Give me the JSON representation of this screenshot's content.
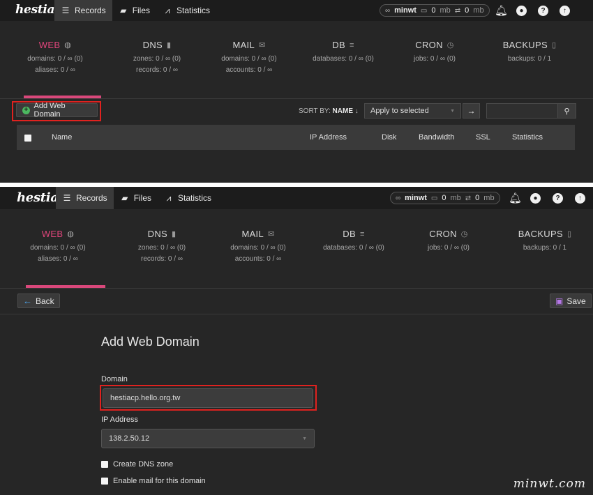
{
  "app": {
    "logo_text": "hestia"
  },
  "nav": {
    "records": "Records",
    "files": "Files",
    "statistics": "Statistics"
  },
  "usage": {
    "user": "minwt",
    "disk_value": "0",
    "disk_unit": "mb",
    "bandwidth_value": "0",
    "bandwidth_unit": "mb"
  },
  "toolbar_icons": [
    "bell-icon",
    "user-icon",
    "help-icon",
    "logout-icon"
  ],
  "stats": [
    {
      "key": "web",
      "title": "WEB",
      "icon": "globe-icon",
      "line1": "domains: 0 / ∞ (0)",
      "line2": "aliases: 0 / ∞",
      "active": true
    },
    {
      "key": "dns",
      "title": "DNS",
      "icon": "book-icon",
      "line1": "zones: 0 / ∞ (0)",
      "line2": "records: 0 / ∞",
      "active": false
    },
    {
      "key": "mail",
      "title": "MAIL",
      "icon": "mail-bulk-icon",
      "line1": "domains: 0 / ∞ (0)",
      "line2": "accounts: 0 / ∞",
      "active": false
    },
    {
      "key": "db",
      "title": "DB",
      "icon": "database-icon",
      "line1": "databases: 0 / ∞ (0)",
      "line2": "",
      "active": false
    },
    {
      "key": "cron",
      "title": "CRON",
      "icon": "clock-icon",
      "line1": "jobs: 0 / ∞ (0)",
      "line2": "",
      "active": false
    },
    {
      "key": "backups",
      "title": "BACKUPS",
      "icon": "file-icon",
      "line1": "backups: 0 / 1",
      "line2": "",
      "active": false
    }
  ],
  "list_toolbar": {
    "add_button": "Add Web Domain",
    "sort_by_label": "SORT BY:",
    "sort_by_value": "NAME",
    "bulk_action": "Apply to selected",
    "search_value": ""
  },
  "table": {
    "columns": [
      "Name",
      "IP Address",
      "Disk",
      "Bandwidth",
      "SSL",
      "Statistics"
    ]
  },
  "form": {
    "back_label": "Back",
    "save_label": "Save",
    "title": "Add Web Domain",
    "domain_label": "Domain",
    "domain_value": "hestiacp.hello.org.tw",
    "ip_label": "IP Address",
    "ip_value": "138.2.50.12",
    "create_dns_label": "Create DNS zone",
    "enable_mail_label": "Enable mail for this domain"
  },
  "watermark": "minwt.com",
  "colors": {
    "accent": "#d9487b",
    "highlight": "#e0221f",
    "add_icon": "#4cb860",
    "back_icon": "#4aa3e8",
    "save_icon": "#b677e8"
  }
}
